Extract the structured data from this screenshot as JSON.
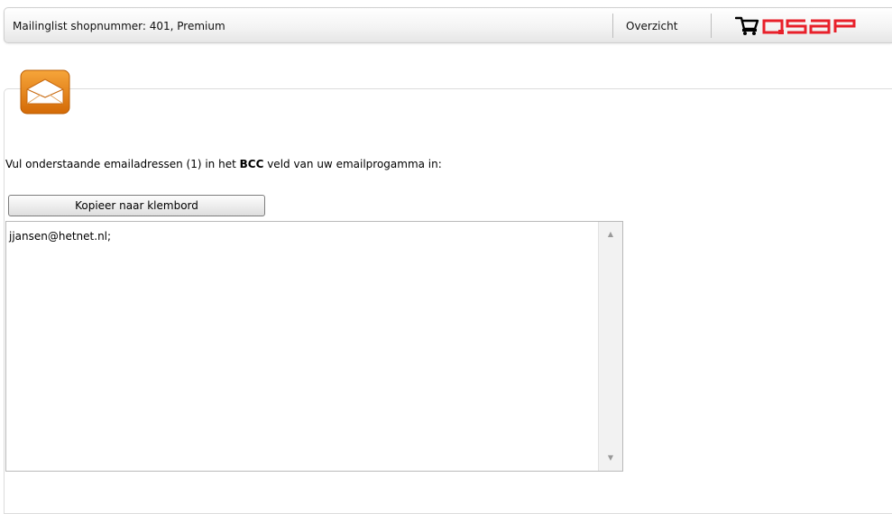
{
  "header": {
    "title": "Mailinglist shopnummer: 401, Premium",
    "overview_link": "Overzicht",
    "logo_text": "QSAP",
    "logo_color": "#e8202a"
  },
  "content": {
    "instruction_before": "Vul onderstaande emailadressen (1) in het ",
    "instruction_bold": "BCC",
    "instruction_after": " veld van uw emailprogamma in:",
    "copy_button_label": "Kopieer naar klembord",
    "email_list": "jjansen@hetnet.nl;"
  },
  "icons": {
    "mail": "mail-envelope-icon",
    "cart": "cart-icon",
    "scroll_up": "scroll-up-arrow-icon",
    "scroll_down": "scroll-down-arrow-icon"
  },
  "colors": {
    "icon_orange": "#e07c10",
    "logo_red": "#e8202a"
  }
}
